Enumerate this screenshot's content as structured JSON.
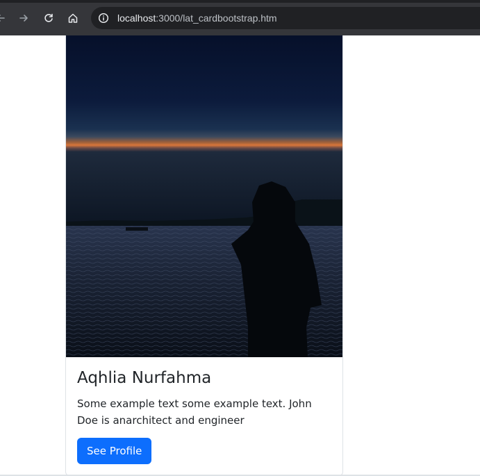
{
  "browser": {
    "url_host": "localhost",
    "url_path": ":3000/lat_cardbootstrap.htm"
  },
  "card": {
    "image": {
      "description_icon": "sunset-silhouette-image"
    },
    "title": "Aqhlia Nurfahma",
    "text": "Some example text some example text. John Doe is anarchitect and engineer",
    "button_label": "See Profile"
  },
  "colors": {
    "button": "#0d6efd",
    "toolbar": "#35363a",
    "omnibox": "#202124",
    "text": "#212529"
  }
}
